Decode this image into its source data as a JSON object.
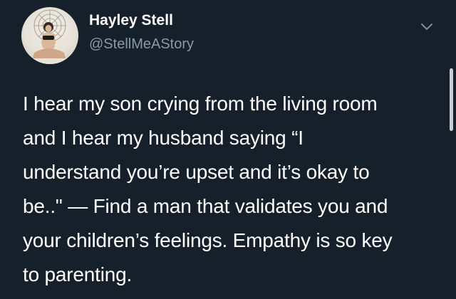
{
  "author": {
    "name": "Hayley Stell",
    "handle": "@StellMeAStory",
    "avatar_icon": "profile-photo"
  },
  "menu": {
    "icon": "chevron-down-icon"
  },
  "tweet": {
    "lines": [
      "I hear my son crying from the living room",
      "and I hear my husband saying “I",
      "understand you’re upset and it’s okay to",
      "be..\" — Find a man that validates you and",
      "your children’s feelings. Empathy is so key",
      "to parenting."
    ]
  },
  "colors": {
    "background": "#15202b",
    "text": "#ffffff",
    "secondary_text": "#8899a6"
  }
}
